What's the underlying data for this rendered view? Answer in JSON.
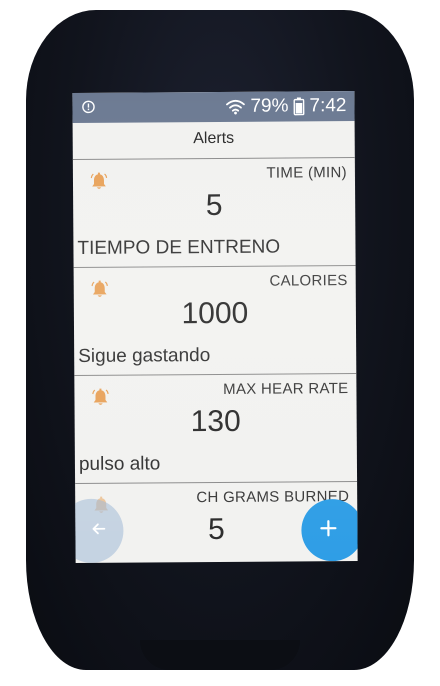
{
  "device": {
    "body_color": "#11141d",
    "screen_color": "#f2f2f0"
  },
  "status_bar": {
    "background": "#6d7b93",
    "left_icon": "alert-circle-icon",
    "wifi_icon": "wifi-icon",
    "battery_percent": "79%",
    "battery_icon": "battery-icon",
    "time": "7:42"
  },
  "header": {
    "title": "Alerts"
  },
  "alerts": [
    {
      "icon": "bell-icon",
      "metric": "TIME (MIN)",
      "value": "5",
      "message": "TIEMPO DE ENTRENO"
    },
    {
      "icon": "bell-icon",
      "metric": "CALORIES",
      "value": "1000",
      "message": "Sigue gastando"
    },
    {
      "icon": "bell-icon",
      "metric": "MAX HEAR RATE",
      "value": "130",
      "message": "pulso alto"
    },
    {
      "icon": "bell-icon",
      "metric": "CH GRAMS BURNED",
      "value": "5",
      "message": ""
    }
  ],
  "buttons": {
    "back_icon": "arrow-left-icon",
    "add_icon": "plus-icon",
    "add_color": "#2f9ee6"
  },
  "colors": {
    "bell": "#e8a25a",
    "divider": "#8c8c8c"
  }
}
